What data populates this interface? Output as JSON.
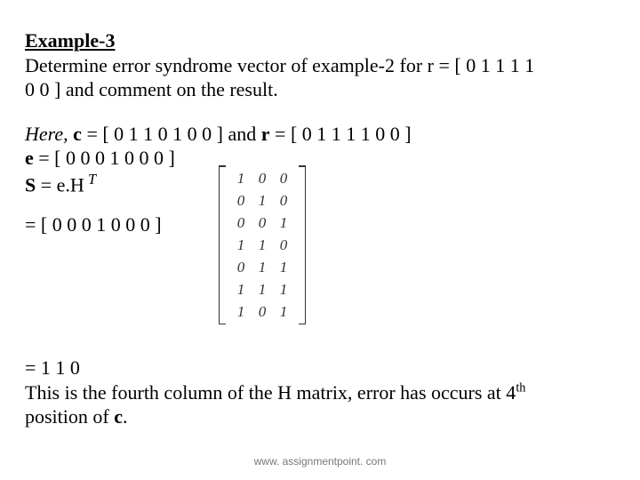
{
  "title": "Example-3",
  "prompt_l1": "Determine  error syndrome vector of example-2 for r = [ 0  1  1  1  1",
  "prompt_l2": "0  0 ] and comment on the result.",
  "here_prefix": "Here, ",
  "c_label": "c",
  "c_value": " = [ 0  1  1  0  1  0  0 ]",
  "and_text": " and  ",
  "r_label": "r",
  "r_value": " = [ 0  1  1  1  1  0  0 ]",
  "e_label": "e",
  "e_value": " = [ 0  0  0  1  0  0  0 ]",
  "S_label": "S",
  "S_eq": "   = e.H",
  "S_sup": " T",
  "eq_row": "=  [ 0  0  0  1  0  0  0 ]",
  "matrix": [
    [
      "1",
      "0",
      "0"
    ],
    [
      "0",
      "1",
      "0"
    ],
    [
      "0",
      "0",
      "1"
    ],
    [
      "1",
      "1",
      "0"
    ],
    [
      "0",
      "1",
      "1"
    ],
    [
      "1",
      "1",
      "1"
    ],
    [
      "1",
      "0",
      "1"
    ]
  ],
  "result_line": " =  1     1     0",
  "conc_l1a": "This is the fourth column of the H matrix,  error has occurs at 4",
  "conc_l1_sup": "th",
  "conc_l2a": "position of ",
  "conc_l2b": "c",
  "conc_l2c": ".",
  "footer": "www. assignmentpoint. com",
  "chart_data": {
    "type": "table",
    "title": "H-transpose (7×3 binary matrix)",
    "rows": [
      [
        1,
        0,
        0
      ],
      [
        0,
        1,
        0
      ],
      [
        0,
        0,
        1
      ],
      [
        1,
        1,
        0
      ],
      [
        0,
        1,
        1
      ],
      [
        1,
        1,
        1
      ],
      [
        1,
        0,
        1
      ]
    ],
    "vectors": {
      "c": [
        0,
        1,
        1,
        0,
        1,
        0,
        0
      ],
      "r": [
        0,
        1,
        1,
        1,
        1,
        0,
        0
      ],
      "e": [
        0,
        0,
        0,
        1,
        0,
        0,
        0
      ],
      "S": [
        1,
        1,
        0
      ]
    }
  }
}
